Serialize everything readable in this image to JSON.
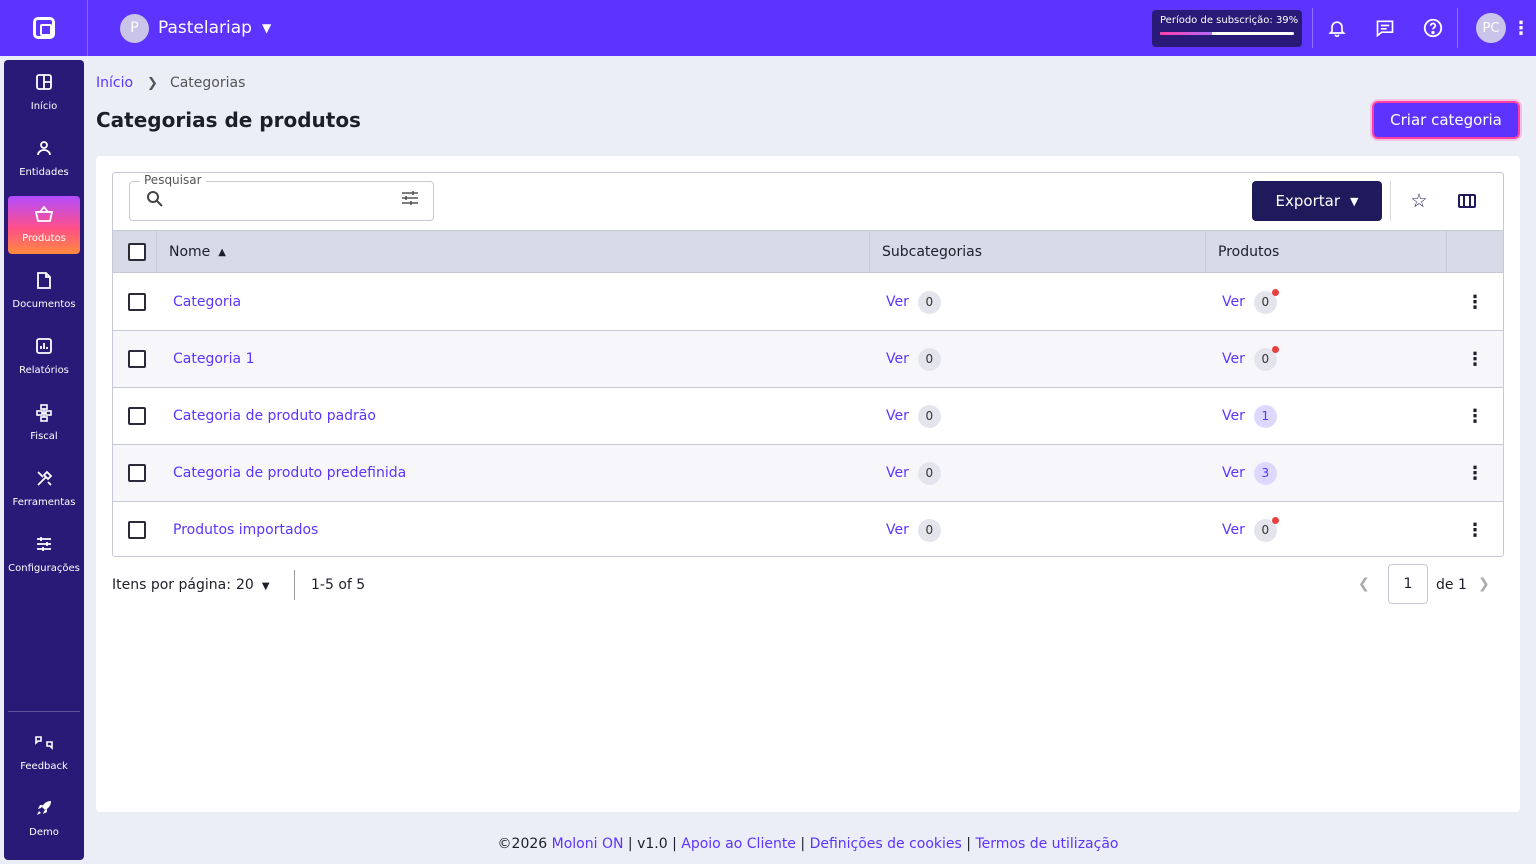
{
  "topbar": {
    "company_initial": "P",
    "company_name": "Pastelariap",
    "subscription_text": "Período de subscrição: 39%",
    "subscription_progress_percent": 39,
    "user_initials": "PC"
  },
  "sidebar": {
    "items": [
      {
        "label": "Início",
        "icon": "grid-icon"
      },
      {
        "label": "Entidades",
        "icon": "user-icon"
      },
      {
        "label": "Produtos",
        "icon": "basket-icon",
        "active": true
      },
      {
        "label": "Documentos",
        "icon": "document-icon"
      },
      {
        "label": "Relatórios",
        "icon": "chart-icon"
      },
      {
        "label": "Fiscal",
        "icon": "fiscal-icon"
      },
      {
        "label": "Ferramentas",
        "icon": "tools-icon"
      },
      {
        "label": "Configurações",
        "icon": "sliders-icon"
      }
    ],
    "bottom_items": [
      {
        "label": "Feedback",
        "icon": "feedback-icon"
      },
      {
        "label": "Demo",
        "icon": "rocket-icon"
      }
    ]
  },
  "breadcrumb": {
    "home": "Início",
    "current": "Categorias"
  },
  "page": {
    "title": "Categorias de produtos",
    "create_button": "Criar categoria"
  },
  "toolbar": {
    "search_label": "Pesquisar",
    "search_value": "",
    "export_label": "Exportar"
  },
  "table": {
    "columns": {
      "name": "Nome",
      "subcategories": "Subcategorias",
      "products": "Produtos"
    },
    "rows": [
      {
        "name": "Categoria",
        "sub_link": "Ver",
        "sub_count": "0",
        "prod_link": "Ver",
        "prod_count": "0",
        "prod_alert": true
      },
      {
        "name": "Categoria 1",
        "sub_link": "Ver",
        "sub_count": "0",
        "prod_link": "Ver",
        "prod_count": "0",
        "prod_alert": true
      },
      {
        "name": "Categoria de produto padrão",
        "sub_link": "Ver",
        "sub_count": "0",
        "prod_link": "Ver",
        "prod_count": "1",
        "prod_alert": false
      },
      {
        "name": "Categoria de produto predefinida",
        "sub_link": "Ver",
        "sub_count": "0",
        "prod_link": "Ver",
        "prod_count": "3",
        "prod_alert": false
      },
      {
        "name": "Produtos importados",
        "sub_link": "Ver",
        "sub_count": "0",
        "prod_link": "Ver",
        "prod_count": "0",
        "prod_alert": true
      }
    ]
  },
  "pagination": {
    "per_page_label": "Itens por página:",
    "per_page_value": "20",
    "range": "1-5 of 5",
    "page": "1",
    "of_total": "de 1"
  },
  "footer": {
    "copyright": "©2026",
    "brand": "Moloni ON",
    "version": "v1.0",
    "support": "Apoio ao Cliente",
    "cookies": "Definições de cookies",
    "terms": "Termos de utilização"
  },
  "colors": {
    "brand": "#5c33ff",
    "sidebar": "#2a1a78",
    "export_button": "#1f1a5c",
    "alert_dot": "#e84040"
  }
}
